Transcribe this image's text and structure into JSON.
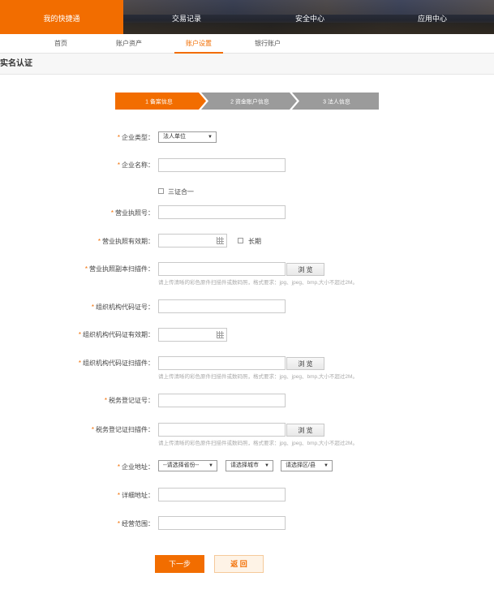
{
  "top_nav": [
    "我的快捷通",
    "交易记录",
    "安全中心",
    "应用中心"
  ],
  "sub_nav": [
    "首页",
    "账户资产",
    "账户设置",
    "银行账户"
  ],
  "section_title": "实名认证",
  "steps": [
    "1 备案信息",
    "2 资金账户信息",
    "3 法人信息"
  ],
  "colors": {
    "accent": "#f26d00",
    "step_inactive": "#9b9b9b"
  },
  "form": {
    "required_mark": "*",
    "enterprise_type_label": "企业类型：",
    "enterprise_type_value": "法人单位",
    "enterprise_name_label": "企业名称：",
    "three_in_one_label": "三证合一",
    "license_no_label": "营业执照号：",
    "license_validity_label": "营业执照有效期：",
    "long_term_label": "长期",
    "license_scan_label": "营业执照副本扫描件：",
    "org_code_label": "组织机构代码证号：",
    "org_code_validity_label": "组织机构代码证有效期：",
    "org_code_scan_label": "组织机构代码证扫描件：",
    "tax_reg_label": "税务登记证号：",
    "tax_reg_scan_label": "税务登记证扫描件：",
    "address_label": "企业地址：",
    "province_placeholder": "--请选择省份--",
    "city_placeholder": "请选择城市",
    "district_placeholder": "请选择区/县",
    "detail_address_label": "详细地址：",
    "business_scope_label": "经营范围：",
    "browse_label": "浏 览",
    "upload_hint": "请上传清晰的彩色原件扫描件或数码照，格式要求：jpg、jpeg、bmp,大小不超过2M。"
  },
  "buttons": {
    "next": "下一步",
    "back": "返 回"
  }
}
